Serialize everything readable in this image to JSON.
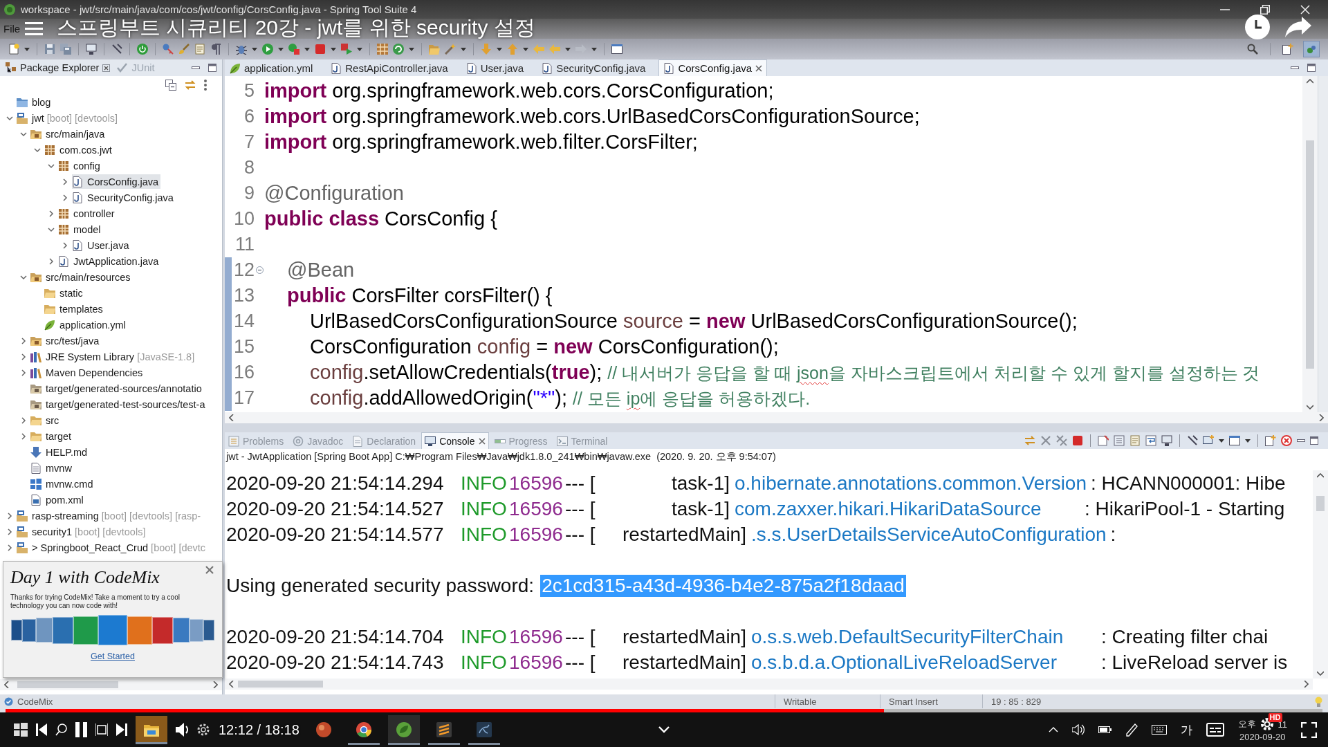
{
  "window": {
    "title": "workspace - jwt/src/main/java/com/cos/jwt/config/CorsConfig.java - Spring Tool Suite 4"
  },
  "video": {
    "title": "스프링부트 시큐리티 20강 - jwt를 위한 security 설정",
    "time": "12:12 / 18:18",
    "quality_badge": "HD",
    "progress": {
      "level": 0.667
    }
  },
  "menu": [
    "File"
  ],
  "explorer": {
    "tabs": [
      {
        "label": "Package Explorer",
        "kind": "packages",
        "selected": true
      },
      {
        "label": "JUnit",
        "kind": "junit",
        "selected": false
      }
    ],
    "tree": [
      {
        "label": "blog",
        "kind": "closed_project",
        "selected": false
      },
      {
        "label": "jwt",
        "decoration": "[boot] [devtools]",
        "kind": "project",
        "expanded": true,
        "selected": false,
        "children": [
          {
            "label": "src/main/java",
            "kind": "source_folder",
            "expanded": true,
            "selected": false,
            "children": [
              {
                "label": "com.cos.jwt",
                "kind": "package",
                "expanded": true,
                "selected": false,
                "children": [
                  {
                    "label": "config",
                    "kind": "package",
                    "expanded": true,
                    "selected": false,
                    "children": [
                      {
                        "label": "CorsConfig.java",
                        "kind": "java_file",
                        "expanded": false,
                        "selected": true
                      },
                      {
                        "label": "SecurityConfig.java",
                        "kind": "java_file",
                        "expanded": false,
                        "selected": false
                      }
                    ]
                  },
                  {
                    "label": "controller",
                    "kind": "package",
                    "expanded": false,
                    "selected": false
                  },
                  {
                    "label": "model",
                    "kind": "package",
                    "expanded": true,
                    "selected": false,
                    "children": [
                      {
                        "label": "User.java",
                        "kind": "java_file",
                        "expanded": false,
                        "selected": false
                      }
                    ]
                  },
                  {
                    "label": "JwtApplication.java",
                    "kind": "java_file",
                    "expanded": false,
                    "selected": false
                  }
                ]
              }
            ]
          },
          {
            "label": "src/main/resources",
            "kind": "source_folder",
            "expanded": true,
            "selected": false,
            "children": [
              {
                "label": "static",
                "kind": "folder",
                "selected": false
              },
              {
                "label": "templates",
                "kind": "folder",
                "selected": false
              },
              {
                "label": "application.yml",
                "kind": "yaml_file",
                "selected": false
              }
            ]
          },
          {
            "label": "src/test/java",
            "kind": "source_folder",
            "expanded": false,
            "selected": false
          },
          {
            "label": "JRE System Library",
            "decoration": "[JavaSE-1.8]",
            "kind": "library",
            "expanded": false,
            "selected": false
          },
          {
            "label": "Maven Dependencies",
            "kind": "library",
            "expanded": false,
            "selected": false
          },
          {
            "label": "target/generated-sources/annotatio",
            "kind": "generated_folder",
            "selected": false
          },
          {
            "label": "target/generated-test-sources/test-a",
            "kind": "generated_folder",
            "selected": false
          },
          {
            "label": "src",
            "kind": "folder",
            "expanded": false,
            "selected": false
          },
          {
            "label": "target",
            "kind": "folder",
            "expanded": false,
            "selected": false
          },
          {
            "label": "HELP.md",
            "kind": "markdown_file",
            "selected": false
          },
          {
            "label": "mvnw",
            "kind": "text_file",
            "selected": false
          },
          {
            "label": "mvnw.cmd",
            "kind": "windows_file",
            "selected": false
          },
          {
            "label": "pom.xml",
            "kind": "xml_file",
            "selected": false
          }
        ]
      },
      {
        "label": "rasp-streaming",
        "decoration": "[boot] [devtools] [rasp-",
        "kind": "project",
        "expanded": false,
        "selected": false
      },
      {
        "label": "security1",
        "decoration": "[boot] [devtools]",
        "kind": "project",
        "expanded": false,
        "selected": false
      },
      {
        "label": "> Springboot_React_Crud",
        "decoration": "[boot] [devtc",
        "kind": "project",
        "expanded": false,
        "selected": false
      }
    ]
  },
  "codemix_popup": {
    "title": "Day 1 with CodeMix",
    "text": "Thanks for trying CodeMix! Take a moment to try a cool technology you can now code with!",
    "link": "Get Started"
  },
  "editor": {
    "tabs": [
      {
        "label": "application.yml",
        "kind": "yaml",
        "selected": false
      },
      {
        "label": "RestApiController.java",
        "kind": "java",
        "selected": false
      },
      {
        "label": "User.java",
        "kind": "java",
        "selected": false
      },
      {
        "label": "SecurityConfig.java",
        "kind": "java",
        "selected": false
      },
      {
        "label": "CorsConfig.java",
        "kind": "java",
        "selected": true
      }
    ],
    "lines": [
      {
        "number": "5",
        "changed": false,
        "tokens": [
          {
            "kind": "keyword",
            "text": "import"
          },
          {
            "kind": "plain",
            "text": " org.springframework.web.cors.CorsConfiguration;"
          }
        ]
      },
      {
        "number": "6",
        "changed": false,
        "tokens": [
          {
            "kind": "keyword",
            "text": "import"
          },
          {
            "kind": "plain",
            "text": " org.springframework.web.cors.UrlBasedCorsConfigurationSource;"
          }
        ]
      },
      {
        "number": "7",
        "changed": false,
        "tokens": [
          {
            "kind": "keyword",
            "text": "import"
          },
          {
            "kind": "plain",
            "text": " org.springframework.web.filter.CorsFilter;"
          }
        ]
      },
      {
        "number": "8",
        "changed": false
      },
      {
        "number": "9",
        "changed": false,
        "tokens": [
          {
            "kind": "annotation",
            "text": "@Configuration"
          }
        ]
      },
      {
        "number": "10",
        "changed": false,
        "tokens": [
          {
            "kind": "keyword",
            "text": "public class"
          },
          {
            "kind": "plain",
            "text": " CorsConfig {"
          }
        ]
      },
      {
        "number": "11",
        "changed": false
      },
      {
        "number": "12",
        "changed": true,
        "expanded": true,
        "tokens": [
          {
            "kind": "annotation",
            "text": "\t@Bean"
          }
        ]
      },
      {
        "number": "13",
        "changed": true,
        "tokens": [
          {
            "kind": "keyword",
            "text": "\tpublic"
          },
          {
            "kind": "plain",
            "text": " CorsFilter corsFilter() {"
          }
        ]
      },
      {
        "number": "14",
        "changed": true,
        "tokens": [
          {
            "kind": "plain",
            "text": "\t\tUrlBasedCorsConfigurationSource "
          },
          {
            "kind": "variable",
            "text": "source"
          },
          {
            "kind": "plain",
            "text": " = "
          },
          {
            "kind": "keyword",
            "text": "new"
          },
          {
            "kind": "plain",
            "text": " UrlBasedCorsConfigurationSource();"
          }
        ]
      },
      {
        "number": "15",
        "changed": true,
        "tokens": [
          {
            "kind": "plain",
            "text": "\t\tCorsConfiguration "
          },
          {
            "kind": "variable",
            "text": "config"
          },
          {
            "kind": "plain",
            "text": " = "
          },
          {
            "kind": "keyword",
            "text": "new"
          },
          {
            "kind": "plain",
            "text": " CorsConfiguration();"
          }
        ]
      },
      {
        "number": "16",
        "changed": true,
        "tokens": [
          {
            "kind": "variable",
            "text": "\t\tconfig"
          },
          {
            "kind": "plain",
            "text": ".setAllowCredentials("
          },
          {
            "kind": "keyword",
            "text": "true"
          },
          {
            "kind": "plain",
            "text": "); "
          },
          {
            "kind": "comment",
            "text": "// 내서버가 응답을 할 때 "
          },
          {
            "kind": "comment_misspelled",
            "text": "json"
          },
          {
            "kind": "comment",
            "text": "을 자바스크립트에서 처리할 수 있게 할지를 설정하는 것"
          }
        ]
      },
      {
        "number": "17",
        "changed": true,
        "tokens": [
          {
            "kind": "variable",
            "text": "\t\tconfig"
          },
          {
            "kind": "plain",
            "text": ".addAllowedOrigin("
          },
          {
            "kind": "string",
            "text": "\"*\""
          },
          {
            "kind": "plain",
            "text": "); "
          },
          {
            "kind": "comment",
            "text": "// 모든 "
          },
          {
            "kind": "comment_misspelled",
            "text": "ip"
          },
          {
            "kind": "comment",
            "text": "에 응답을 허용하겠다."
          }
        ]
      }
    ]
  },
  "console": {
    "tabs": [
      {
        "label": "Problems",
        "kind": "problems",
        "selected": false
      },
      {
        "label": "Javadoc",
        "kind": "javadoc",
        "selected": false
      },
      {
        "label": "Declaration",
        "kind": "declaration",
        "selected": false
      },
      {
        "label": "Console",
        "kind": "console",
        "selected": true
      },
      {
        "label": "Progress",
        "kind": "progress",
        "selected": false
      },
      {
        "label": "Terminal",
        "kind": "terminal",
        "selected": false
      }
    ],
    "process": "jwt - JwtApplication [Spring Boot App] C:₩Program Files₩Java₩jdk1.8.0_241₩bin₩javaw.exe  (2020. 9. 20. 오후 9:54:07)",
    "lines": [
      {
        "kind": "log",
        "timestamp": "2020-09-20 21:54:14.294",
        "severity": "INFO",
        "pid": "16596",
        "separator": "--- [",
        "thread": "task-1]",
        "logger": "o.hibernate.annotations.common.Version",
        "message": ": HCANN000001: Hibe"
      },
      {
        "kind": "log",
        "timestamp": "2020-09-20 21:54:14.527",
        "severity": "INFO",
        "pid": "16596",
        "separator": "--- [",
        "thread": "task-1]",
        "logger": "com.zaxxer.hikari.HikariDataSource",
        "message": ": HikariPool-1 - Starting"
      },
      {
        "kind": "log",
        "timestamp": "2020-09-20 21:54:14.577",
        "severity": "INFO",
        "pid": "16596",
        "separator": "--- [",
        "thread": "restartedMain]",
        "logger": ".s.s.UserDetailsServiceAutoConfiguration",
        "message": ":"
      },
      {
        "kind": "blank"
      },
      {
        "kind": "password",
        "label": "Using generated security password:",
        "value": "2c1cd315-a43d-4936-b4e2-875a2f18daad",
        "selected": true
      },
      {
        "kind": "blank"
      },
      {
        "kind": "log",
        "timestamp": "2020-09-20 21:54:14.704",
        "severity": "INFO",
        "pid": "16596",
        "separator": "--- [",
        "thread": "restartedMain]",
        "logger": "o.s.s.web.DefaultSecurityFilterChain",
        "message": ": Creating filter chai"
      },
      {
        "kind": "log",
        "timestamp": "2020-09-20 21:54:14.743",
        "severity": "INFO",
        "pid": "16596",
        "separator": "--- [",
        "thread": "restartedMain]",
        "logger": "o.s.b.d.a.OptionalLiveReloadServer",
        "message": ": LiveReload server is"
      }
    ]
  },
  "status_bar": {
    "plugin": "CodeMix",
    "write_mode": "Writable",
    "insert_mode": "Smart Insert",
    "position": "19 : 85 : 829"
  },
  "taskbar": {
    "ime": "가",
    "clock_start": "오후",
    "clock_end": "11",
    "date": "2020-09-20"
  }
}
